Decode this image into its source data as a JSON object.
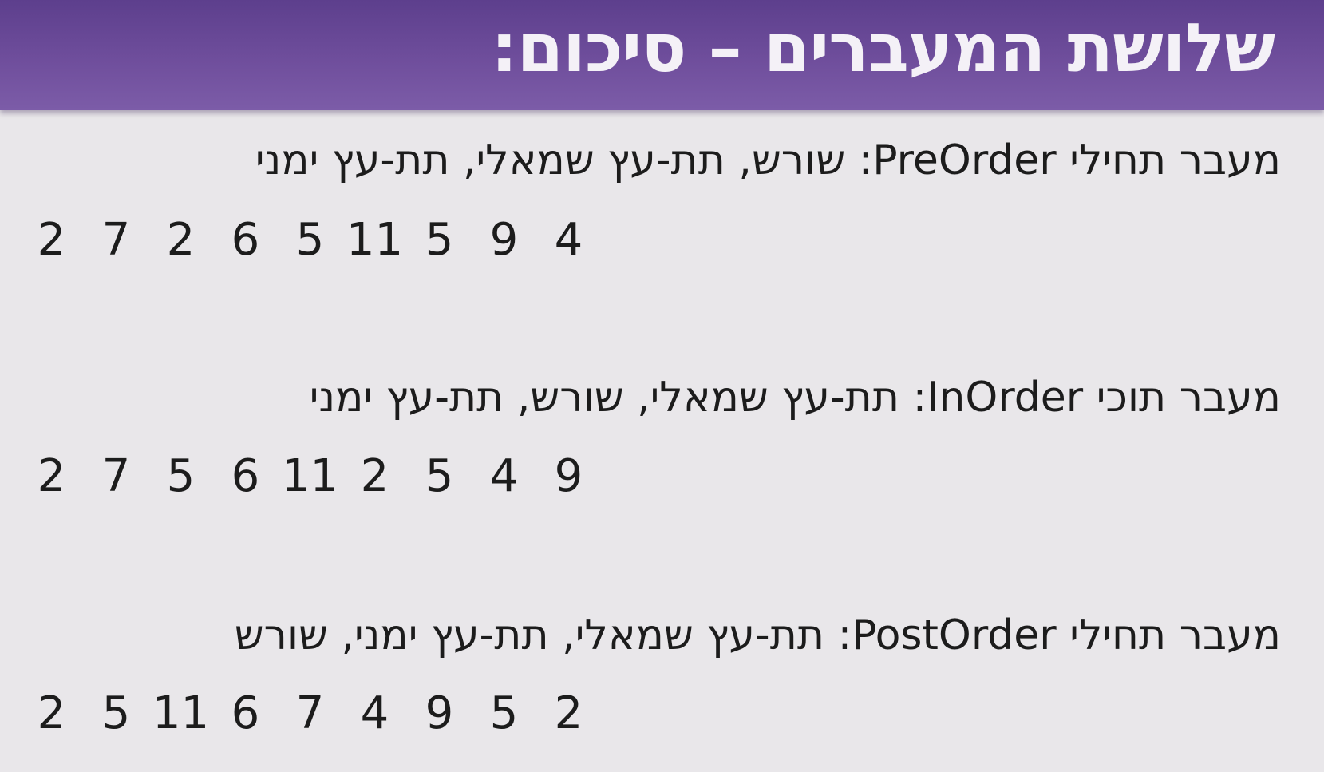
{
  "slide": {
    "title": "שלושת המעברים – סיכום:"
  },
  "traversals": [
    {
      "name_he": "מעבר תחילי",
      "name_en": "PreOrder",
      "order": "שורש, תת-עץ שמאלי, תת-עץ ימני",
      "sequence": [
        "2",
        "7",
        "2",
        "6",
        "5",
        "11",
        "5",
        "9",
        "4"
      ]
    },
    {
      "name_he": "מעבר תוכי",
      "name_en": "InOrder",
      "order": "תת-עץ שמאלי, שורש, תת-עץ ימני",
      "sequence": [
        "2",
        "7",
        "5",
        "6",
        "11",
        "2",
        "5",
        "4",
        "9"
      ]
    },
    {
      "name_he": "מעבר תחילי",
      "name_en": "PostOrder",
      "order": "תת-עץ שמאלי, תת-עץ ימני, שורש",
      "sequence": [
        "2",
        "5",
        "11",
        "6",
        "7",
        "4",
        "9",
        "5",
        "2"
      ]
    }
  ],
  "colors": {
    "title_bar": "#6f4e9c",
    "title_text": "#f4f1f7",
    "background": "#e9e7ea",
    "body_text": "#1c1c1c"
  }
}
